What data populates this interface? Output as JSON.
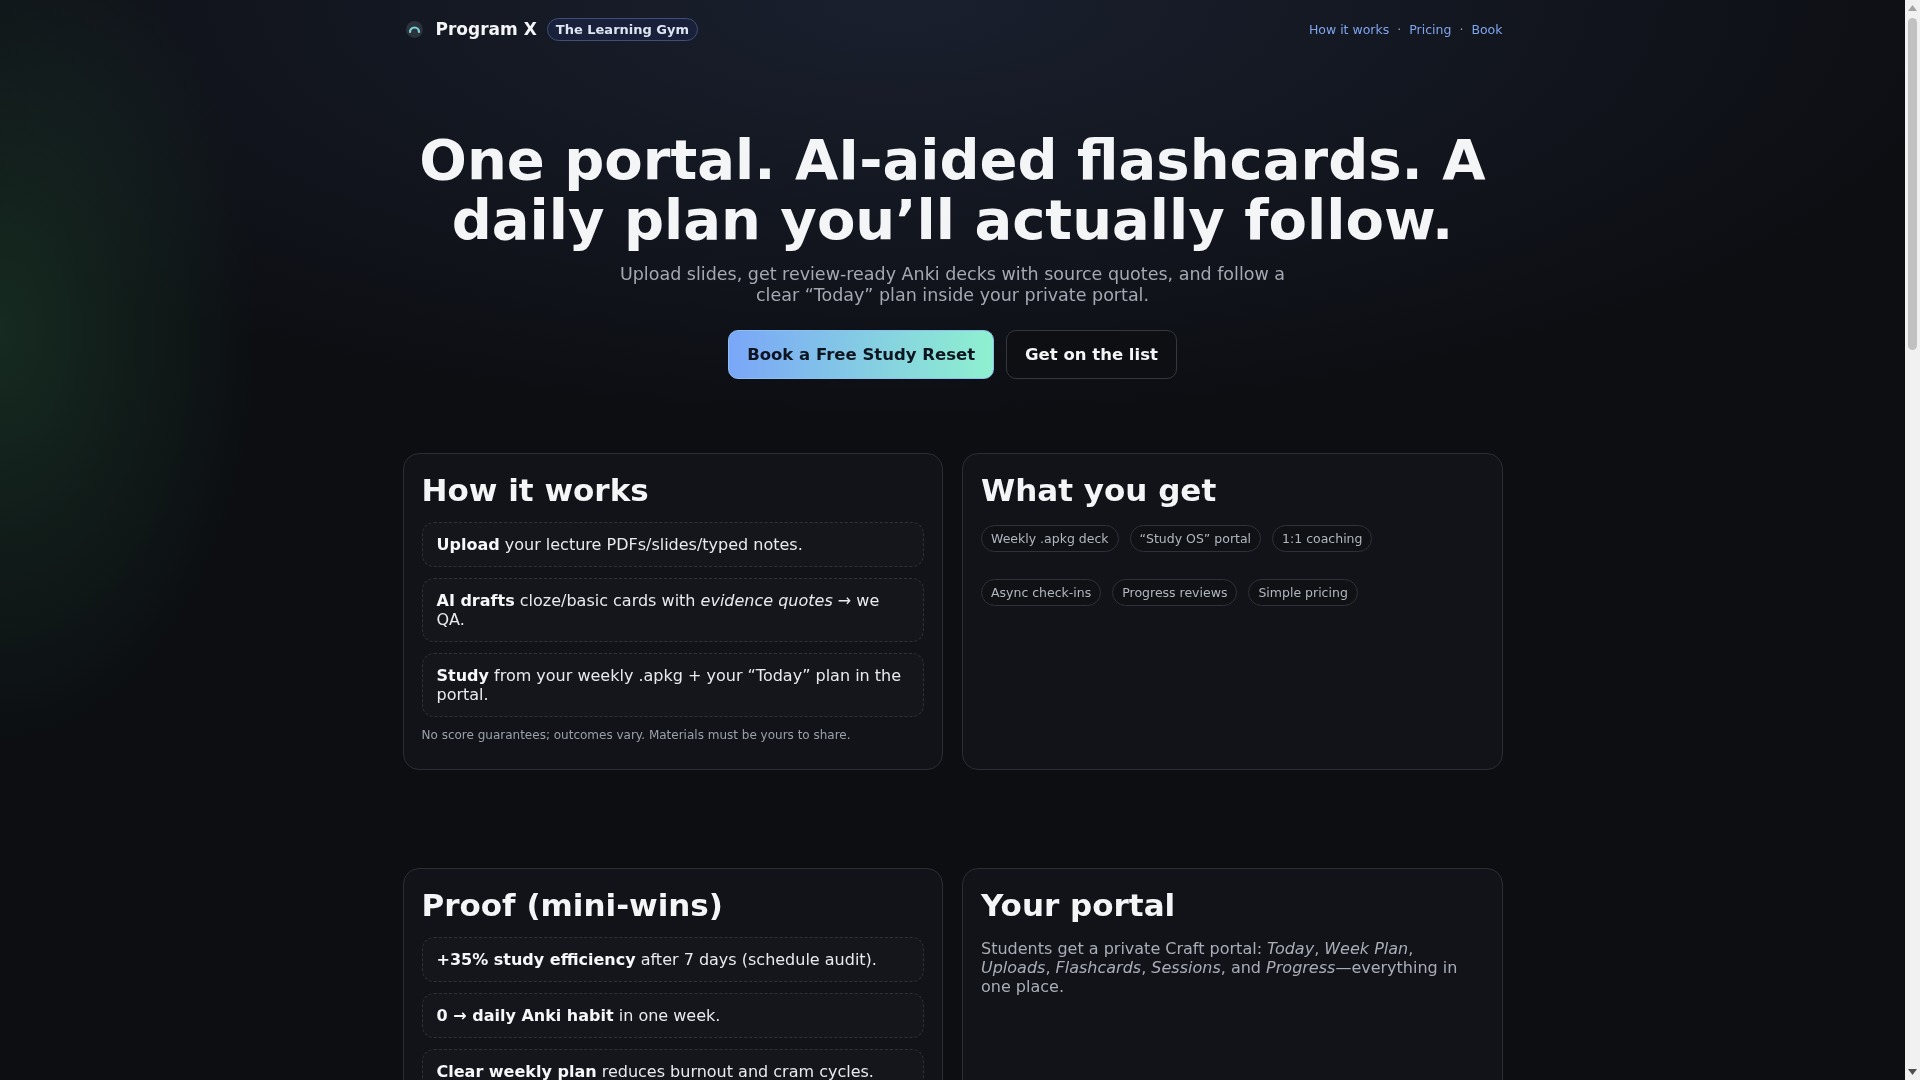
{
  "header": {
    "brand": "Program X",
    "badge": "The Learning Gym",
    "nav": {
      "links": [
        "How it works",
        "Pricing",
        "Book"
      ],
      "separator": "·"
    }
  },
  "hero": {
    "title": "One portal. AI-aided flashcards. A daily plan you’ll actually follow.",
    "subtitle": "Upload slides, get review-ready Anki decks with source quotes, and follow a clear “Today” plan inside your private portal.",
    "buttons": [
      {
        "label": "Book a Free Study Reset",
        "kind": "primary"
      },
      {
        "label": "Get on the list",
        "kind": "secondary"
      }
    ]
  },
  "sections": [
    {
      "kind": "steps",
      "title": "How it works",
      "items": [
        "**Upload** your lecture PDFs/slides/typed notes.",
        "**AI drafts** cloze/basic cards with *evidence quotes* → we QA.",
        "**Study** from your weekly .apkg + your “Today” plan in the portal."
      ],
      "note": "No score guarantees; outcomes vary. Materials must be yours to share."
    },
    {
      "kind": "chips",
      "title": "What you get",
      "chip_rows": [
        [
          "Weekly .apkg deck",
          "“Study OS” portal",
          "1:1 coaching"
        ],
        [
          "Async check-ins",
          "Progress reviews",
          "Simple pricing"
        ]
      ]
    },
    {
      "kind": "steps",
      "title": "Proof (mini-wins)",
      "items": [
        "**+35% study efficiency** after 7 days (schedule audit).",
        "**0 → daily Anki habit** in one week.",
        "**Clear weekly plan** reduces burnout and cram cycles."
      ]
    },
    {
      "kind": "text",
      "title": "Your portal",
      "text": "Students get a private Craft portal: *Today*, *Week Plan*, *Uploads*, *Flashcards*, *Sessions*, and *Progress*—everything in one place."
    }
  ]
}
